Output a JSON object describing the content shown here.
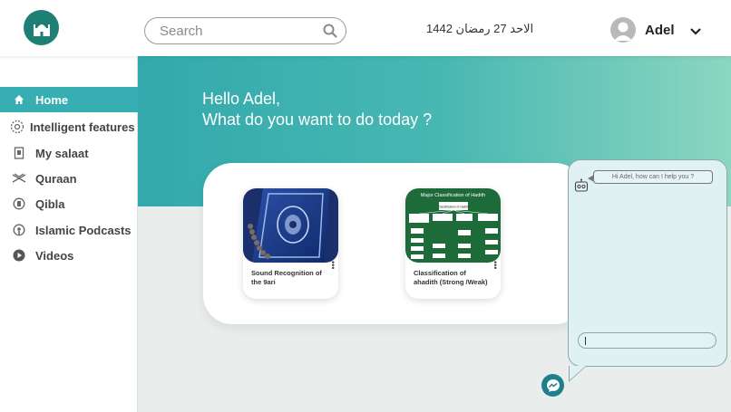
{
  "header": {
    "logo_icon": "mosque-icon",
    "search": {
      "placeholder": "Search",
      "icon": "search-icon"
    },
    "date": "الاحد  27  رمضان 1442",
    "user": {
      "name": "Adel",
      "avatar_icon": "user-icon",
      "menu_icon": "chevron-down-icon"
    }
  },
  "sidebar": {
    "items": [
      {
        "label": "Home",
        "icon": "home-icon",
        "active": true
      },
      {
        "label": "Intelligent features",
        "icon": "brain-icon",
        "active": false
      },
      {
        "label": "My salaat",
        "icon": "prayer-icon",
        "active": false
      },
      {
        "label": "Quraan",
        "icon": "quran-stand-icon",
        "active": false
      },
      {
        "label": "Qibla",
        "icon": "qibla-icon",
        "active": false
      },
      {
        "label": "Islamic Podcasts",
        "icon": "podcast-icon",
        "active": false
      },
      {
        "label": "Videos",
        "icon": "play-icon",
        "active": false
      }
    ]
  },
  "main": {
    "greeting_line1": "Hello Adel,",
    "greeting_line2": "What do you want to do today ?",
    "cards": [
      {
        "title": "Sound Recognition of the 9ari",
        "image": "quran-book-image",
        "menu_icon": "more-vertical-icon"
      },
      {
        "title": "Classification of ahadith (Strong /Weak)",
        "image": "hadith-classification-diagram",
        "menu_icon": "more-vertical-icon"
      }
    ],
    "diagram_thumb": {
      "title": "Major Classification of Hadith",
      "root": "Classification of Hadith"
    }
  },
  "chat": {
    "bot_icon": "robot-icon",
    "message": "Hi Adel, how can I help you ?",
    "input_value": "",
    "launcher_icon": "messenger-icon"
  },
  "colors": {
    "accent": "#37aeb1",
    "logo_bg": "#1e7f74",
    "hero_start": "#33a9ad",
    "hero_end": "#8bd6c0",
    "chat_bg": "#dff1f2",
    "diagram_bg": "#1e6b3a"
  }
}
